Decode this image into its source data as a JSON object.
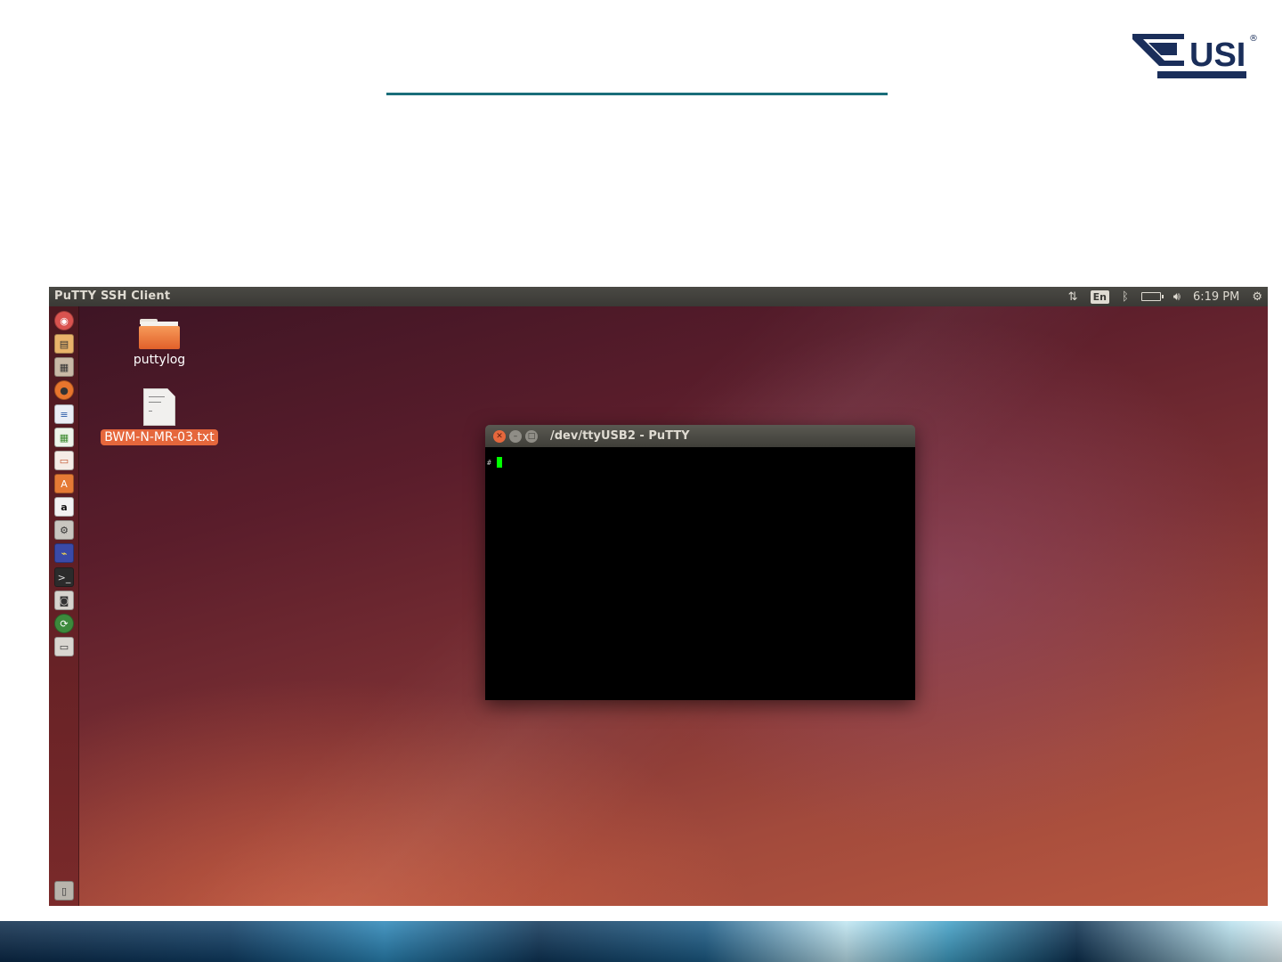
{
  "slide": {
    "logo_text": "USI",
    "logo_mark": "®",
    "colors": {
      "rule": "#1a6e7a",
      "logo": "#1a2e5a"
    }
  },
  "topbar": {
    "app_title": "PuTTY SSH Client",
    "lang": "En",
    "clock": "6:19 PM",
    "icons": [
      "network-updown-icon",
      "bluetooth-icon",
      "battery-icon",
      "volume-icon",
      "settings-gear-icon"
    ]
  },
  "launcher": {
    "icons": [
      "ubuntu-dash-icon",
      "files-icon",
      "archive-icon",
      "firefox-icon",
      "writer-icon",
      "calc-icon",
      "impress-icon",
      "software-center-icon",
      "amazon-icon",
      "system-settings-icon",
      "putty-icon",
      "terminal-icon",
      "screenshot-icon",
      "update-manager-icon",
      "disk-icon",
      "trash-icon"
    ]
  },
  "desktop": {
    "icons": [
      {
        "label": "puttylog",
        "type": "folder"
      },
      {
        "label": "BWM-N-MR-03.txt",
        "type": "text-file",
        "selected": true
      }
    ]
  },
  "window": {
    "title": "/dev/ttyUSB2 - PuTTY",
    "terminal_prompt": "#",
    "colors": {
      "cursor": "#00ff00",
      "close_button": "#e5673c"
    }
  }
}
